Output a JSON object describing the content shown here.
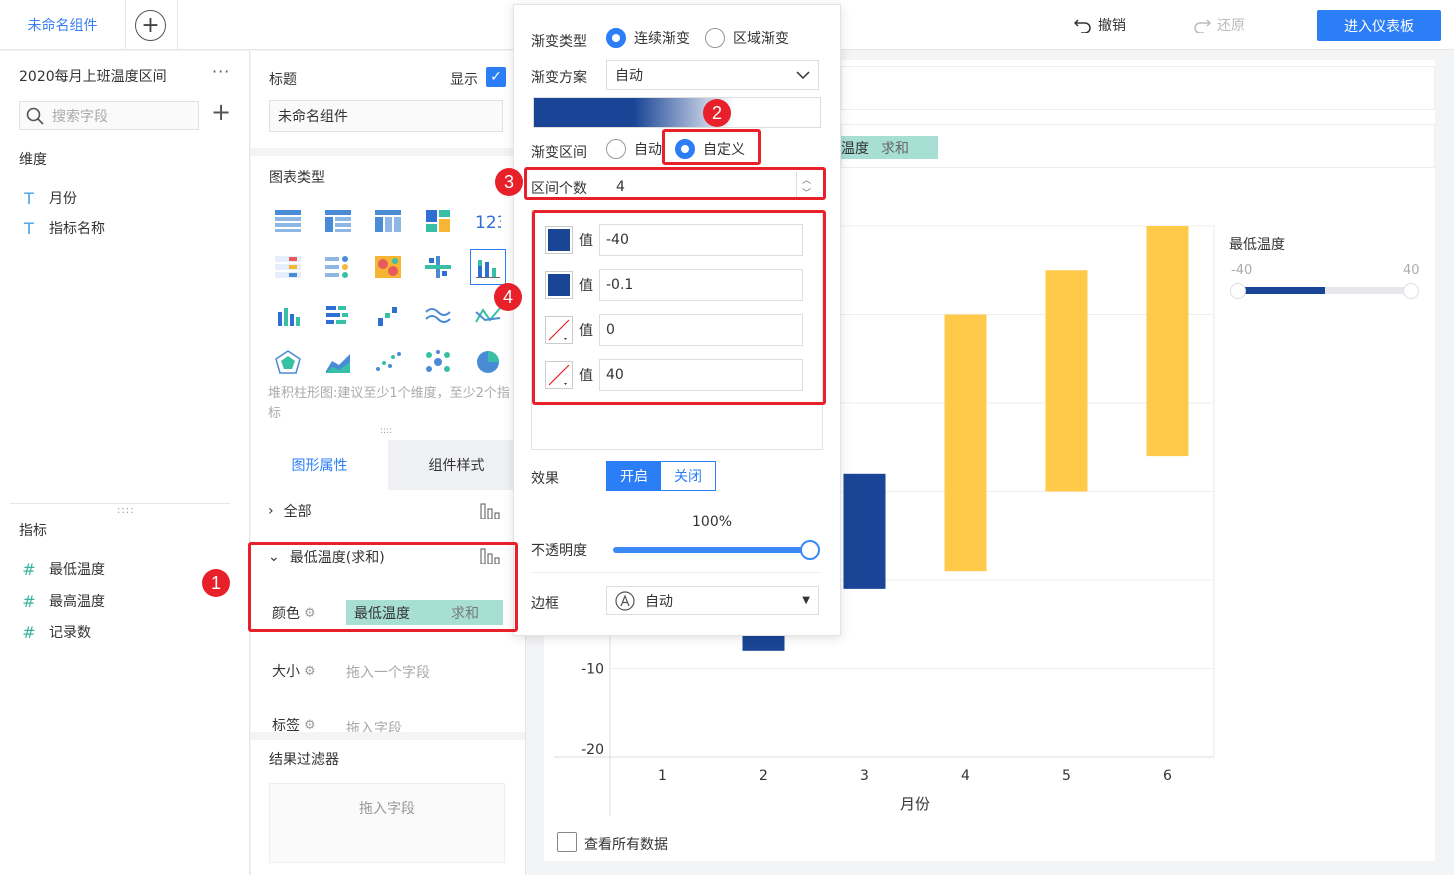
{
  "topbar": {
    "tab_name": "未命名组件",
    "undo_label": "撤销",
    "redo_label": "还原",
    "enter_dashboard_label": "进入仪表板"
  },
  "left": {
    "dataset_title": "2020每月上班温度区间",
    "more": "···",
    "search_placeholder": "搜索字段",
    "dimensions_title": "维度",
    "dimensions": [
      "月份",
      "指标名称"
    ],
    "measures_title": "指标",
    "measures": [
      "最低温度",
      "最高温度",
      "记录数"
    ]
  },
  "mid": {
    "title_label": "标题",
    "show_label": "显示",
    "title_value": "未命名组件",
    "chart_type_label": "图表类型",
    "chart_hint": "堆积柱形图:建议至少1个维度，至少2个指标",
    "tab_prop": "图形属性",
    "tab_style": "组件样式",
    "all_label": "全部",
    "mintemp_label": "最低温度(求和)",
    "color_label": "颜色",
    "color_field": "最低温度",
    "color_agg": "求和",
    "size_label": "大小",
    "size_placeholder": "拖入一个字段",
    "label_label": "标签",
    "label_placeholder": "拖入字段",
    "filter_label": "结果过滤器",
    "filter_placeholder": "拖入字段"
  },
  "popup": {
    "gradient_type_label": "渐变类型",
    "gradient_type_options": [
      "连续渐变",
      "区域渐变"
    ],
    "scheme_label": "渐变方案",
    "scheme_value": "自动",
    "range_label": "渐变区间",
    "range_options": [
      "自动",
      "自定义"
    ],
    "count_label": "区间个数",
    "count_value": "4",
    "value_label": "值",
    "values": [
      "-40",
      "-0.1",
      "0",
      "40"
    ],
    "effect_label": "效果",
    "effect_on": "开启",
    "effect_off": "关闭",
    "opacity_label": "不透明度",
    "opacity_value": "100%",
    "border_label": "边框",
    "border_value": "自动"
  },
  "canvas": {
    "pill_field": "温度",
    "pill_agg": "求和",
    "legend_title": "最低温度",
    "legend_min": "-40",
    "legend_max": "40",
    "view_all_label": "查看所有数据"
  },
  "badges": [
    "1",
    "2",
    "3",
    "4"
  ],
  "colors": {
    "accent": "#2c7ef6",
    "dark_blue": "#1a4596",
    "bar_yellow": "#ffc94a",
    "annotation_red": "#e8202a"
  },
  "chart_data": {
    "type": "bar",
    "categories": [
      "1",
      "2",
      "3",
      "4",
      "5",
      "6"
    ],
    "series": [
      {
        "name": "最低温度",
        "lows": [
          -5,
          -8,
          -1,
          1,
          10,
          14
        ],
        "highs": [
          -3,
          -4,
          12,
          30,
          35,
          40
        ]
      }
    ],
    "y_tick_labels": [
      "-10",
      "-20"
    ],
    "xlabel": "月份",
    "ylabel": "",
    "ylim": [
      -20,
      40
    ]
  }
}
